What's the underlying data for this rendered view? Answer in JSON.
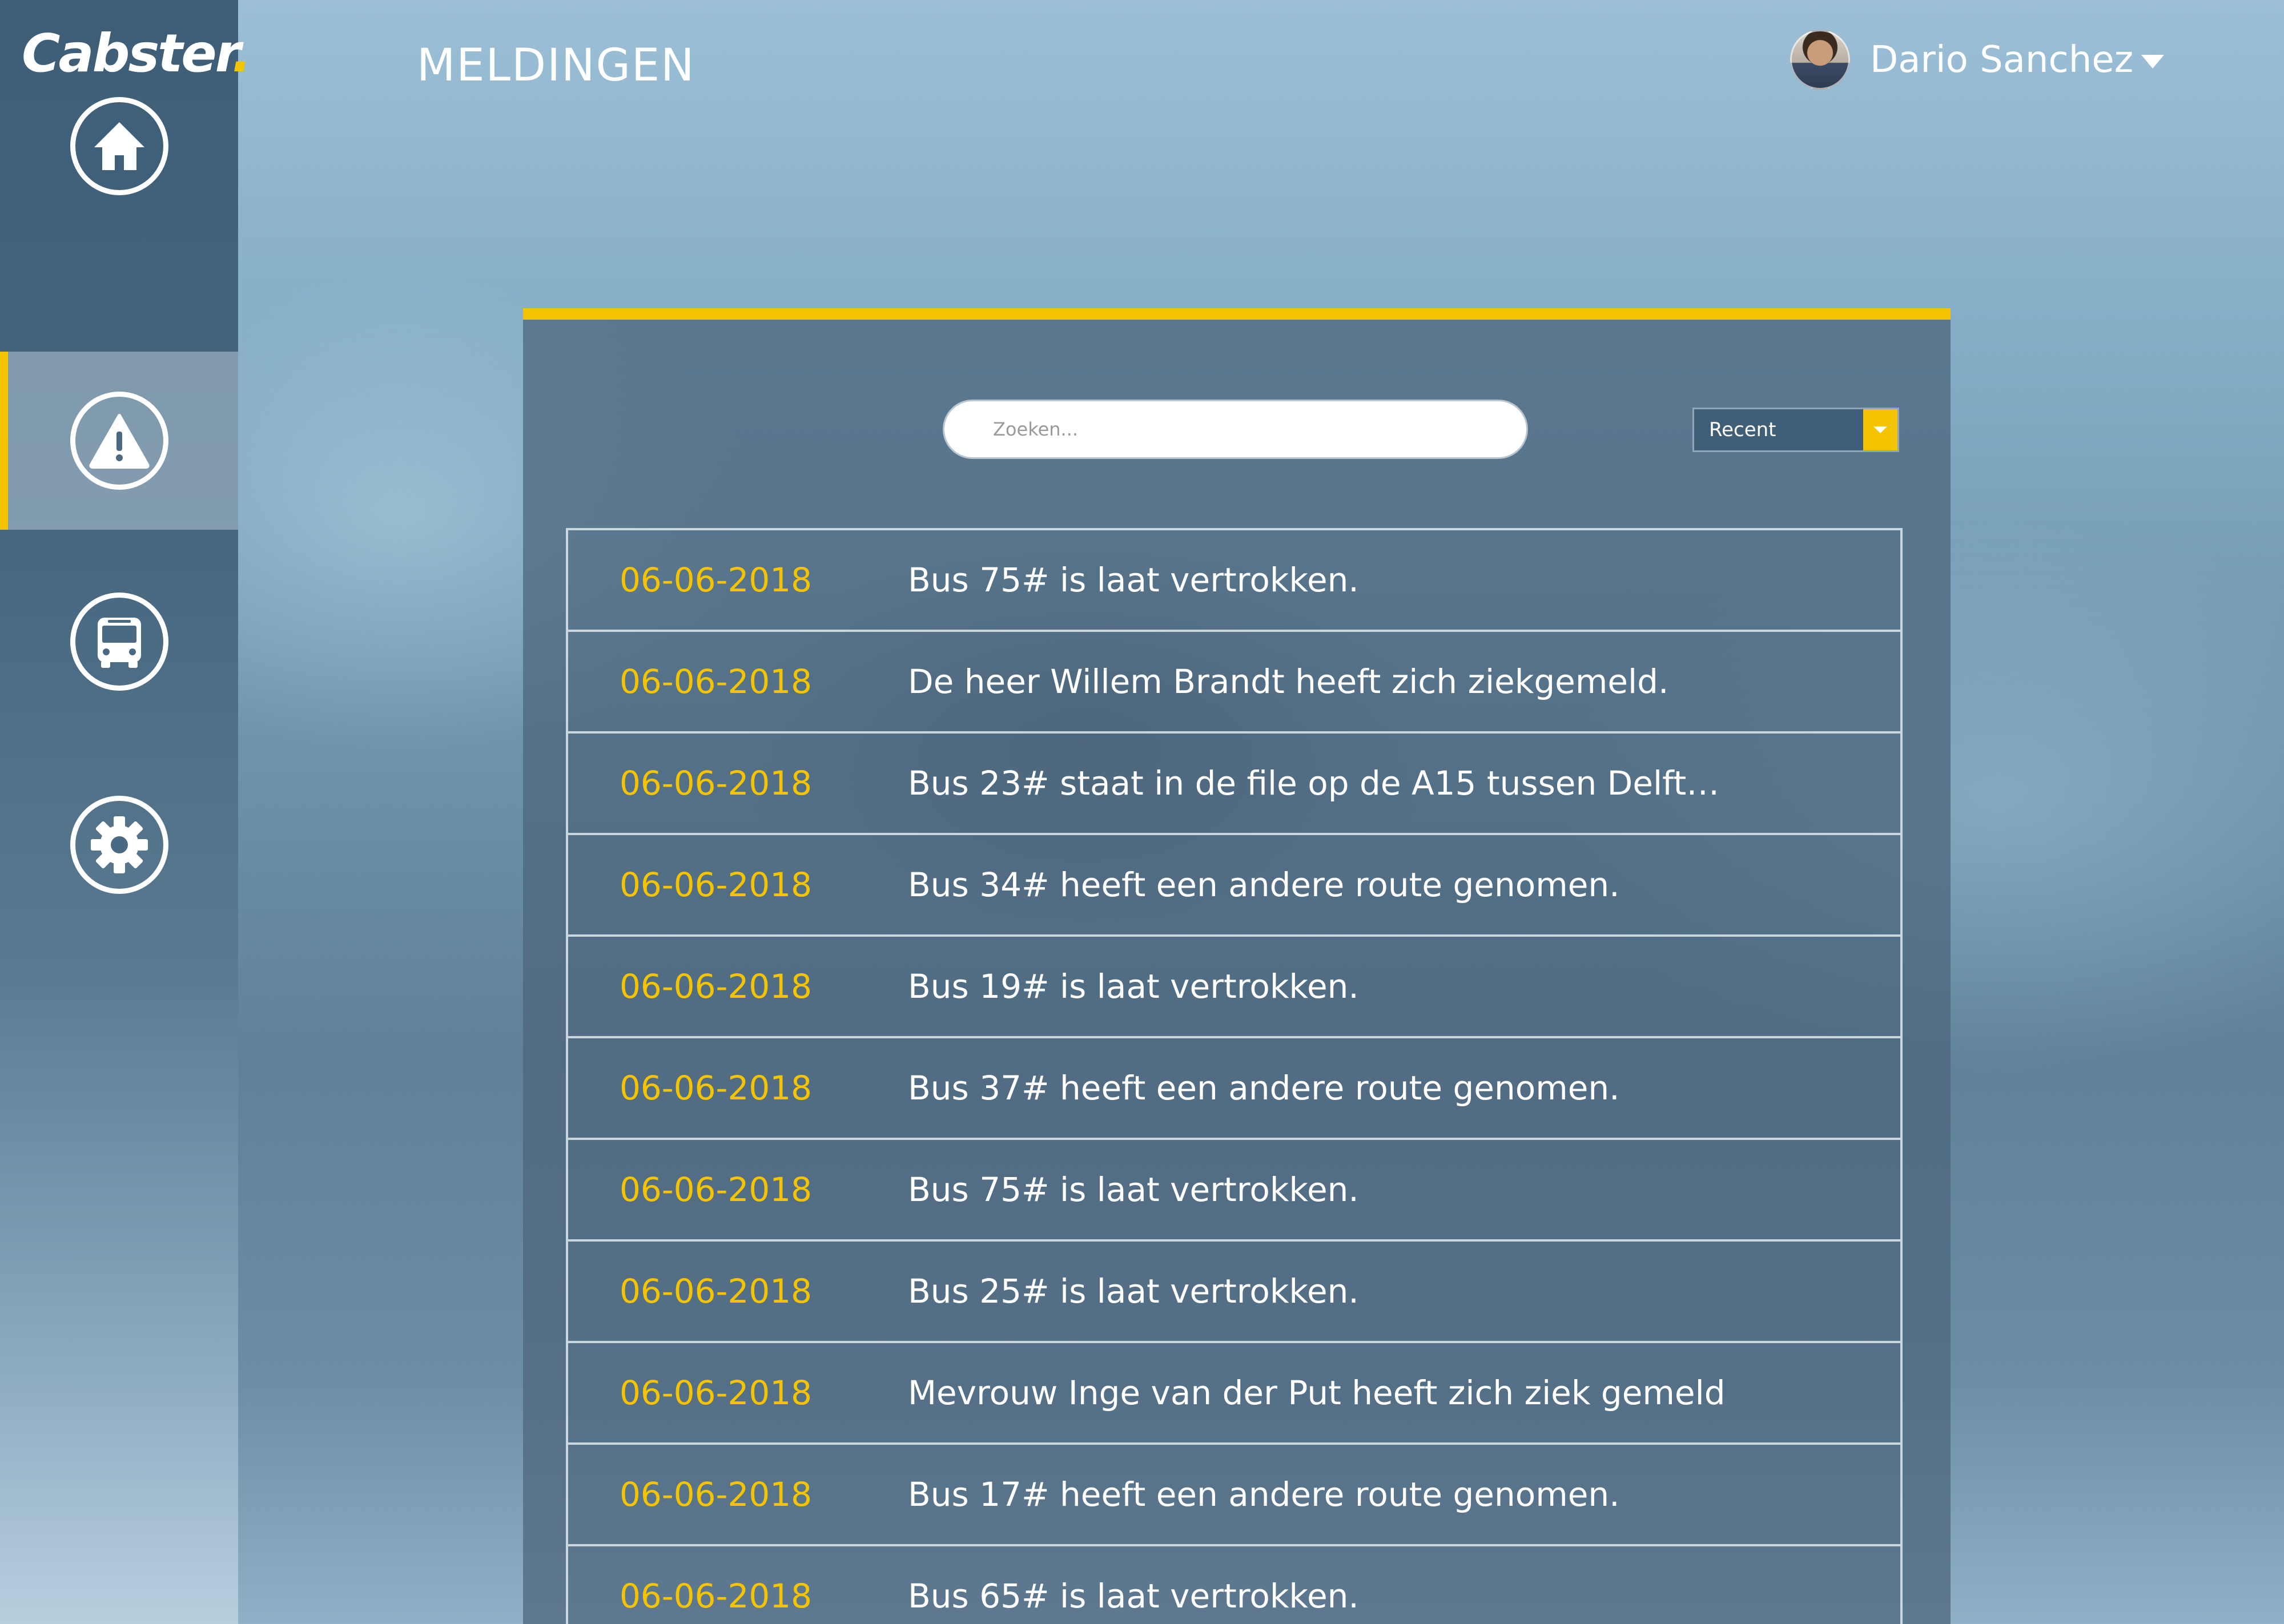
{
  "app": {
    "logo_text": "Cabster",
    "logo_dot": ".",
    "accent_color": "#f5c400"
  },
  "sidebar": {
    "items": [
      {
        "name": "home",
        "icon": "home-icon",
        "active": false
      },
      {
        "name": "meldingen",
        "icon": "warning-icon",
        "active": true
      },
      {
        "name": "bus",
        "icon": "bus-icon",
        "active": false
      },
      {
        "name": "settings",
        "icon": "gear-icon",
        "active": false
      }
    ]
  },
  "header": {
    "title": "MELDINGEN",
    "user_name": "Dario Sanchez"
  },
  "search": {
    "placeholder": "Zoeken..."
  },
  "sort": {
    "selected": "Recent"
  },
  "notifications": [
    {
      "date": "06-06-2018",
      "message": "Bus 75# is laat vertrokken."
    },
    {
      "date": "06-06-2018",
      "message": "De heer Willem Brandt heeft zich ziekgemeld."
    },
    {
      "date": "06-06-2018",
      "message": "Bus 23# staat in de file op de  A15 tussen Delft…"
    },
    {
      "date": "06-06-2018",
      "message": "Bus 34# heeft een andere route genomen."
    },
    {
      "date": "06-06-2018",
      "message": "Bus 19# is laat vertrokken."
    },
    {
      "date": "06-06-2018",
      "message": "Bus 37# heeft een andere route genomen."
    },
    {
      "date": "06-06-2018",
      "message": "Bus 75# is laat vertrokken."
    },
    {
      "date": "06-06-2018",
      "message": "Bus 25# is laat vertrokken."
    },
    {
      "date": "06-06-2018",
      "message": "Mevrouw Inge van der Put heeft zich ziek gemeld"
    },
    {
      "date": "06-06-2018",
      "message": "Bus 17# heeft een andere route genomen."
    },
    {
      "date": "06-06-2018",
      "message": "Bus 65# is laat vertrokken."
    }
  ]
}
